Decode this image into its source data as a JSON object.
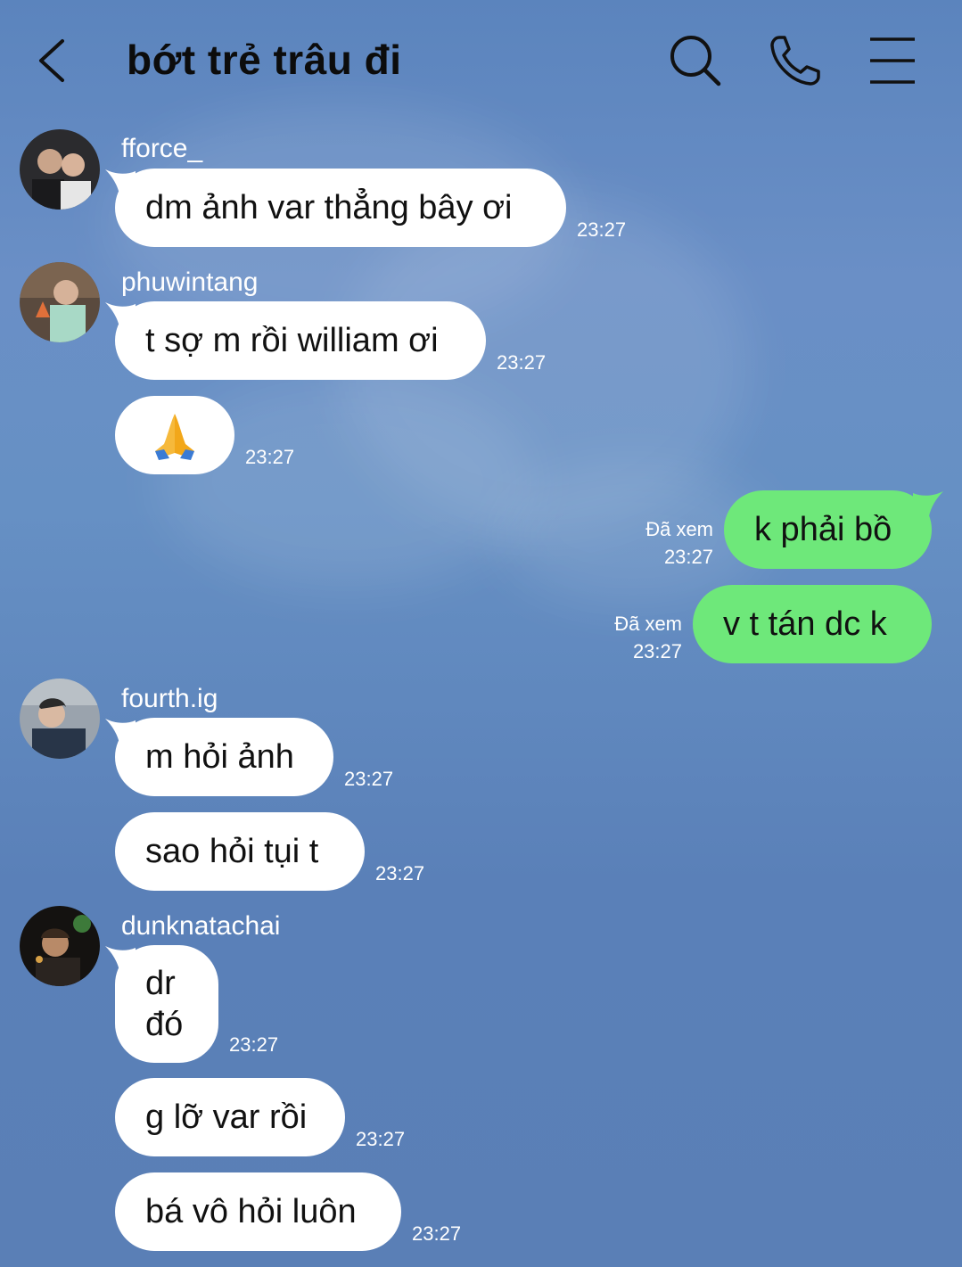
{
  "header": {
    "title": "bớt trẻ trâu đi",
    "back_icon": "chevron-left-icon",
    "search_icon": "search-icon",
    "phone_icon": "phone-icon",
    "menu_icon": "menu-icon"
  },
  "colors": {
    "background": "#5b84bd",
    "incoming_bubble": "#ffffff",
    "outgoing_bubble": "#6ee87a",
    "text": "#111111"
  },
  "messages": [
    {
      "sender": "fforce_",
      "text": "dm ảnh var thẳng bây ơi",
      "time": "23:27"
    },
    {
      "sender": "phuwintang",
      "text": "t sợ m rồi william ơi",
      "time": "23:27"
    },
    {
      "sender": "phuwintang",
      "text": "🙏",
      "time": "23:27"
    },
    {
      "sender": "me",
      "text": "k phải bồ",
      "time": "23:27",
      "status": "Đã xem"
    },
    {
      "sender": "me",
      "text": "v t tán dc k",
      "time": "23:27",
      "status": "Đã xem"
    },
    {
      "sender": "fourth.ig",
      "text": "m hỏi ảnh",
      "time": "23:27"
    },
    {
      "sender": "fourth.ig",
      "text": "sao hỏi tụi t",
      "time": "23:27"
    },
    {
      "sender": "dunknatachai",
      "text_line1": "dr",
      "text_line2": "đó",
      "time": "23:27"
    },
    {
      "sender": "dunknatachai",
      "text": "g lỡ var rồi",
      "time": "23:27"
    },
    {
      "sender": "dunknatachai",
      "text": "bá vô hỏi luôn",
      "time": "23:27"
    }
  ]
}
